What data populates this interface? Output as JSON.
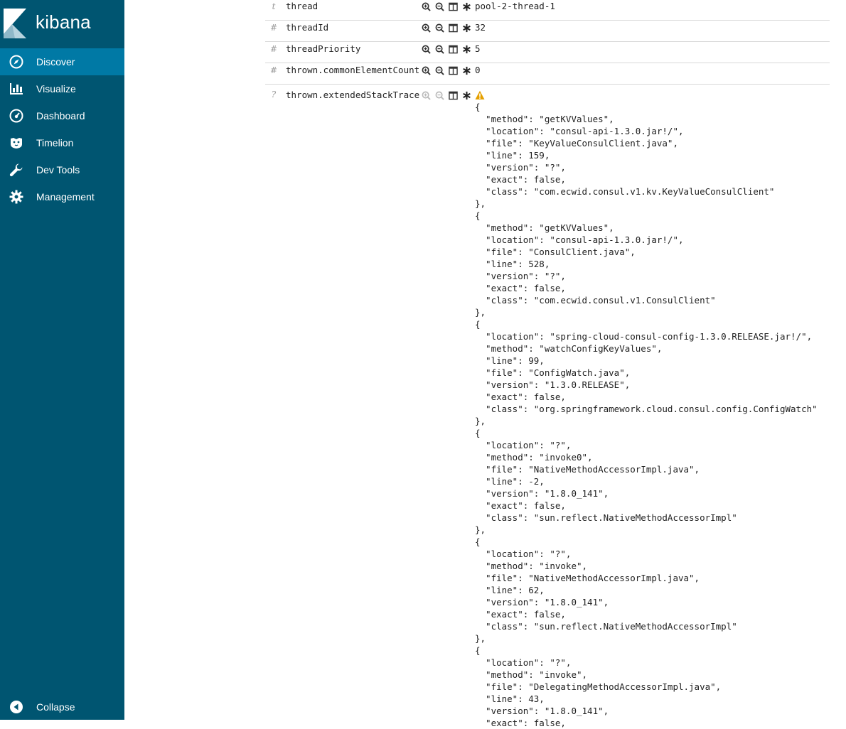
{
  "app": {
    "logo_text": "kibana"
  },
  "sidebar": {
    "items": [
      {
        "label": "Discover",
        "icon": "compass-icon",
        "active": true
      },
      {
        "label": "Visualize",
        "icon": "bar-chart-icon",
        "active": false
      },
      {
        "label": "Dashboard",
        "icon": "gauge-icon",
        "active": false
      },
      {
        "label": "Timelion",
        "icon": "timelion-icon",
        "active": false
      },
      {
        "label": "Dev Tools",
        "icon": "wrench-icon",
        "active": false
      },
      {
        "label": "Management",
        "icon": "gear-icon",
        "active": false
      }
    ],
    "collapse_label": "Collapse"
  },
  "fields": [
    {
      "type_symbol": "t",
      "name": "thread",
      "value": "pool-2-thread-1"
    },
    {
      "type_symbol": "#",
      "name": "threadId",
      "value": "32"
    },
    {
      "type_symbol": "#",
      "name": "threadPriority",
      "value": "5"
    },
    {
      "type_symbol": "#",
      "name": "thrown.commonElementCount",
      "value": "0"
    }
  ],
  "stack_trace_field": {
    "type_symbol": "?",
    "name": "thrown.extendedStackTrace",
    "warning_icon": "warning-icon",
    "value": "{\n  \"method\": \"getKVValues\",\n  \"location\": \"consul-api-1.3.0.jar!/\",\n  \"file\": \"KeyValueConsulClient.java\",\n  \"line\": 159,\n  \"version\": \"?\",\n  \"exact\": false,\n  \"class\": \"com.ecwid.consul.v1.kv.KeyValueConsulClient\"\n},\n{\n  \"method\": \"getKVValues\",\n  \"location\": \"consul-api-1.3.0.jar!/\",\n  \"file\": \"ConsulClient.java\",\n  \"line\": 528,\n  \"version\": \"?\",\n  \"exact\": false,\n  \"class\": \"com.ecwid.consul.v1.ConsulClient\"\n},\n{\n  \"location\": \"spring-cloud-consul-config-1.3.0.RELEASE.jar!/\",\n  \"method\": \"watchConfigKeyValues\",\n  \"line\": 99,\n  \"file\": \"ConfigWatch.java\",\n  \"version\": \"1.3.0.RELEASE\",\n  \"exact\": false,\n  \"class\": \"org.springframework.cloud.consul.config.ConfigWatch\"\n},\n{\n  \"location\": \"?\",\n  \"method\": \"invoke0\",\n  \"file\": \"NativeMethodAccessorImpl.java\",\n  \"line\": -2,\n  \"version\": \"1.8.0_141\",\n  \"exact\": false,\n  \"class\": \"sun.reflect.NativeMethodAccessorImpl\"\n},\n{\n  \"location\": \"?\",\n  \"method\": \"invoke\",\n  \"file\": \"NativeMethodAccessorImpl.java\",\n  \"line\": 62,\n  \"version\": \"1.8.0_141\",\n  \"exact\": false,\n  \"class\": \"sun.reflect.NativeMethodAccessorImpl\"\n},\n{\n  \"location\": \"?\",\n  \"method\": \"invoke\",\n  \"file\": \"DelegatingMethodAccessorImpl.java\",\n  \"line\": 43,\n  \"version\": \"1.8.0_141\",\n  \"exact\": false,"
  },
  "colors": {
    "sidebar_bg": "#005571",
    "sidebar_active": "#0079a5",
    "warning": "#e5a000"
  }
}
